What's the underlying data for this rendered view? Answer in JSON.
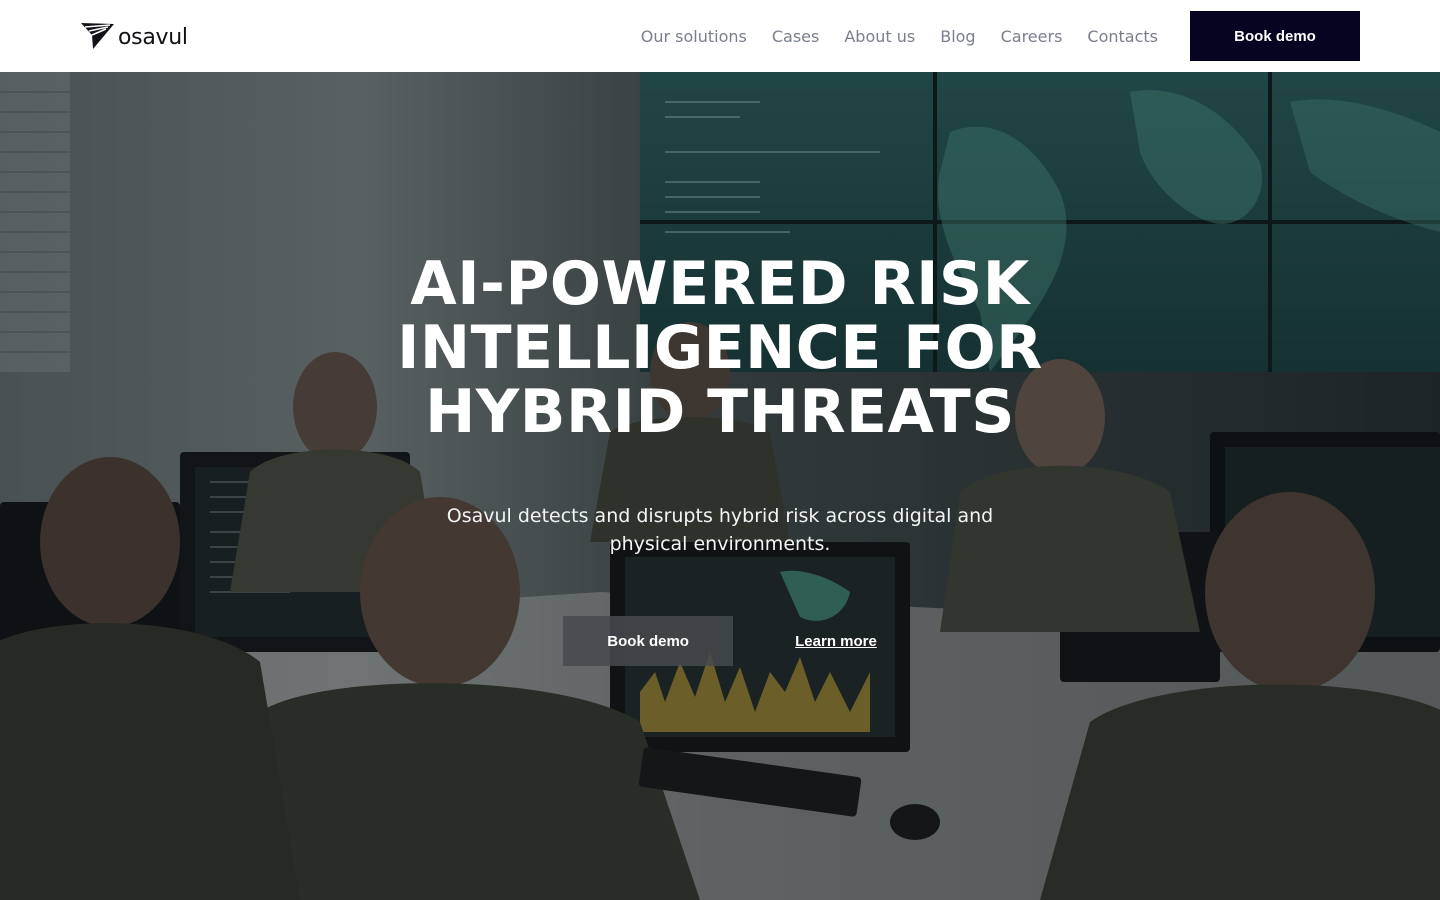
{
  "brand": {
    "name": "osavul",
    "logo_icon": "paper-plane-icon"
  },
  "nav": {
    "items": [
      {
        "label": "Our solutions"
      },
      {
        "label": "Cases"
      },
      {
        "label": "About us"
      },
      {
        "label": "Blog"
      },
      {
        "label": "Careers"
      },
      {
        "label": "Contacts"
      }
    ],
    "cta_label": "Book demo"
  },
  "hero": {
    "title": "AI-POWERED RISK INTELLIGENCE FOR HYBRID THREATS",
    "subtitle": "Osavul detects and disrupts hybrid risk across digital and physical environments.",
    "primary_label": "Book demo",
    "secondary_label": "Learn more",
    "background_image": "operations-room-photo"
  },
  "colors": {
    "cta_dark": "#060420",
    "nav_text": "#7a7f8c",
    "screen_glow": "#3f9f8c",
    "hero_text": "#ffffff"
  }
}
